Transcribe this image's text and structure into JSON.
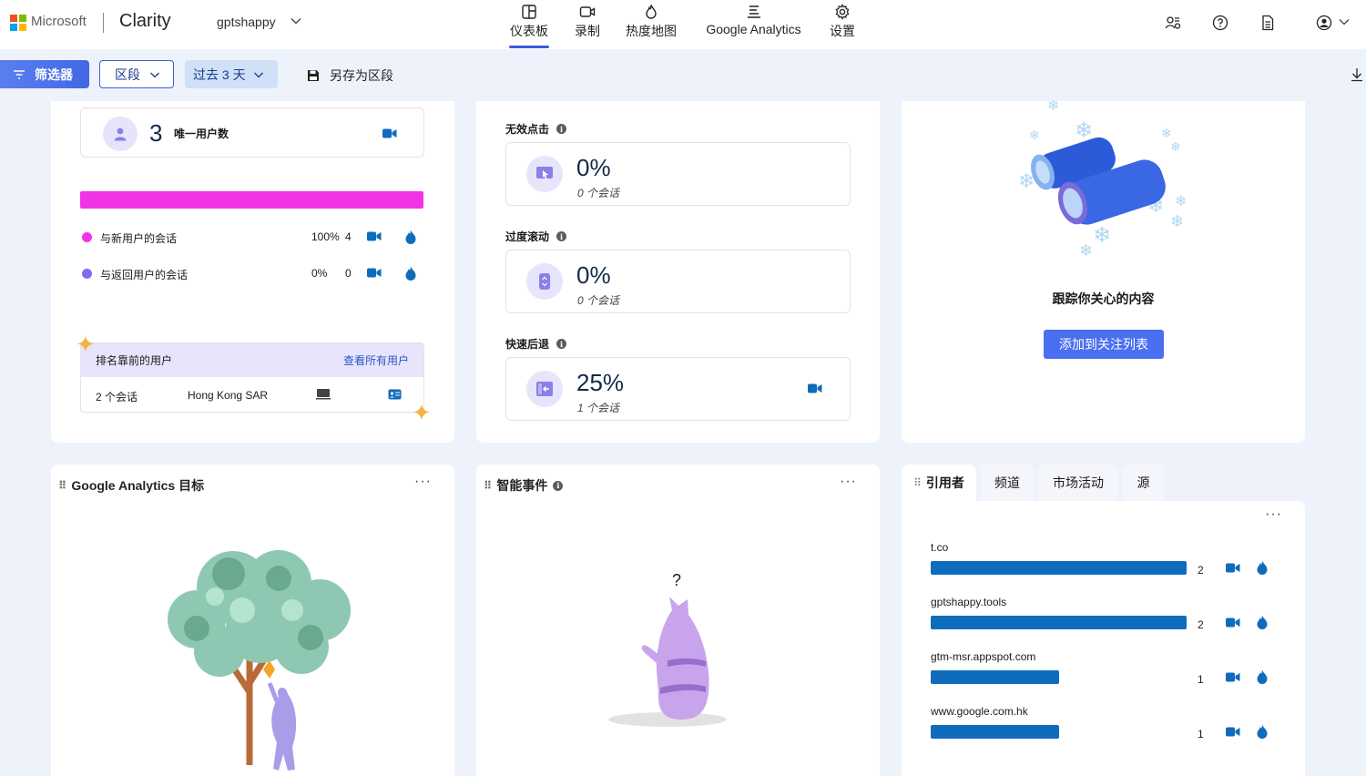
{
  "header": {
    "ms_name": "Microsoft",
    "app_name": "Clarity",
    "project": "gptshappy",
    "nav": [
      {
        "label": "仪表板",
        "icon": "dashboard-icon",
        "active": true
      },
      {
        "label": "录制",
        "icon": "video-icon"
      },
      {
        "label": "热度地图",
        "icon": "flame-icon"
      },
      {
        "label": "Google Analytics",
        "icon": "analytics-icon"
      },
      {
        "label": "设置",
        "icon": "gear-icon"
      }
    ]
  },
  "toolbar": {
    "filter_label": "筛选器",
    "segment_label": "区段",
    "range_label": "过去 3 天",
    "save_label": "另存为区段"
  },
  "users_card": {
    "count": "3",
    "label": "唯一用户数",
    "legend": [
      {
        "label": "与新用户的会话",
        "pct": "100%",
        "count": "4",
        "color": "#f034e5"
      },
      {
        "label": "与返回用户的会话",
        "pct": "0%",
        "count": "0",
        "color": "#7b6cf0"
      }
    ],
    "new_user_fraction": 1.0,
    "top_users": {
      "title": "排名靠前的用户",
      "link": "查看所有用户",
      "row": {
        "sessions": "2 个会话",
        "location": "Hong Kong SAR"
      }
    }
  },
  "metrics_card": {
    "items": [
      {
        "label": "无效点击",
        "value": "0%",
        "sub": "0 个会话"
      },
      {
        "label": "过度滚动",
        "value": "0%",
        "sub": "0 个会话"
      },
      {
        "label": "快速后退",
        "value": "25%",
        "sub": "1 个会话"
      }
    ]
  },
  "watch_card": {
    "title": "跟踪你关心的内容",
    "button": "添加到关注列表"
  },
  "ga_card": {
    "title": "Google Analytics 目标"
  },
  "smart_events_card": {
    "title": "智能事件",
    "question": "?"
  },
  "referrers_card": {
    "tabs": [
      "引用者",
      "频道",
      "市场活动",
      "源"
    ],
    "rows": [
      {
        "name": "t.co",
        "count": "2",
        "fraction": 1.0
      },
      {
        "name": "gptshappy.tools",
        "count": "2",
        "fraction": 1.0
      },
      {
        "name": "gtm-msr.appspot.com",
        "count": "1",
        "fraction": 0.5
      },
      {
        "name": "www.google.com.hk",
        "count": "1",
        "fraction": 0.5
      }
    ]
  },
  "colors": {
    "accent": "#3e5bd8",
    "bar": "#0f6cbd",
    "pink": "#f034e5",
    "purple": "#7b6cf0"
  }
}
